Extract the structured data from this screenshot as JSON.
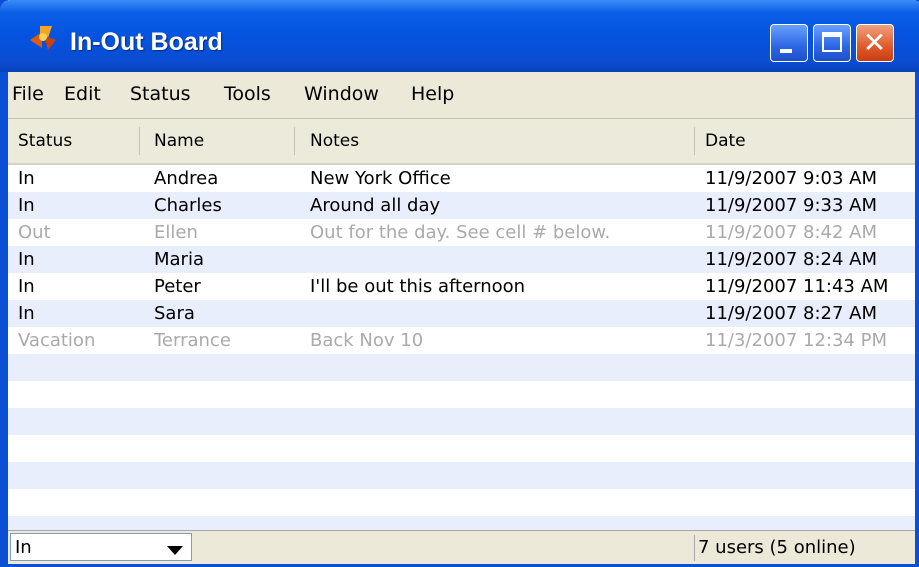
{
  "window": {
    "title": "In-Out Board",
    "controls": {
      "minimize": "minimize",
      "maximize": "maximize",
      "close": "✕"
    }
  },
  "menu": [
    "File",
    "Edit",
    "Status",
    "Tools",
    "Window",
    "Help"
  ],
  "columns": [
    "Status",
    "Name",
    "Notes",
    "Date"
  ],
  "rows": [
    {
      "status": "In",
      "name": "Andrea",
      "notes": "New York Office",
      "date": "11/9/2007 9:03 AM",
      "dim": false
    },
    {
      "status": "In",
      "name": "Charles",
      "notes": "Around all day",
      "date": "11/9/2007 9:33 AM",
      "dim": false
    },
    {
      "status": "Out",
      "name": "Ellen",
      "notes": "Out for the day.  See cell # below.",
      "date": "11/9/2007 8:42 AM",
      "dim": true
    },
    {
      "status": "In",
      "name": "Maria",
      "notes": "",
      "date": "11/9/2007 8:24 AM",
      "dim": false
    },
    {
      "status": "In",
      "name": "Peter",
      "notes": "I'll be out this afternoon",
      "date": "11/9/2007 11:43 AM",
      "dim": false
    },
    {
      "status": "In",
      "name": "Sara",
      "notes": "",
      "date": "11/9/2007 8:27 AM",
      "dim": false
    },
    {
      "status": "Vacation",
      "name": "Terrance",
      "notes": "Back Nov 10",
      "date": "11/3/2007 12:34 PM",
      "dim": true
    }
  ],
  "statusbar": {
    "status_value": "In",
    "user_count": "7 users (5 online)"
  },
  "colors": {
    "titlebar": "#0553e0",
    "stripe": "#e8eefb",
    "dim_text": "#aaaaaa",
    "close_button": "#e05a2a"
  },
  "icons": {
    "app": "app-icon",
    "dropdown": "chevron-down-icon"
  }
}
